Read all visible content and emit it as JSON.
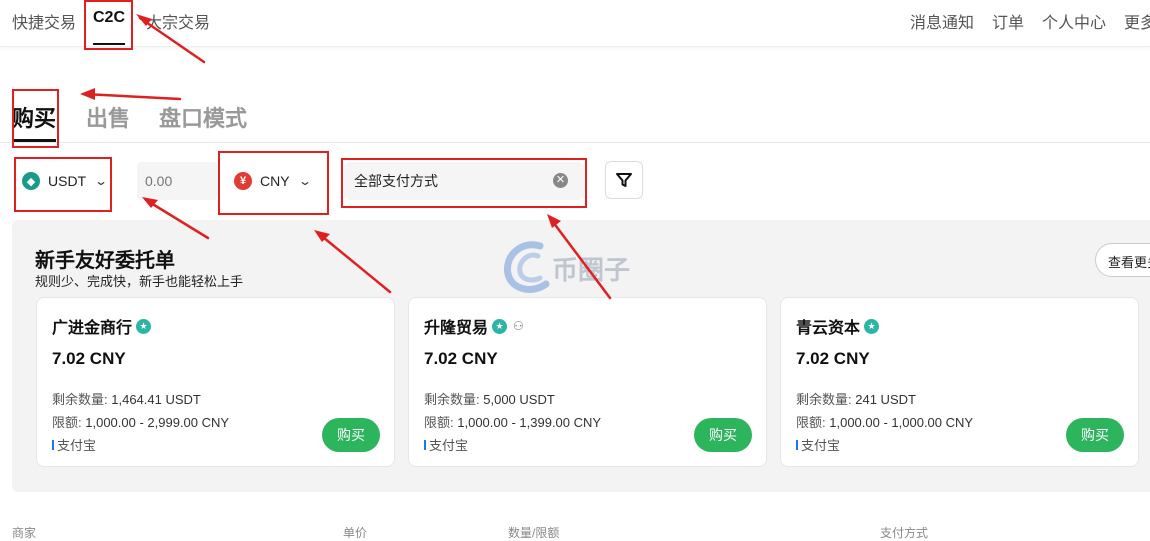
{
  "topnav": {
    "left": [
      "快捷交易",
      "C2C",
      "大宗交易"
    ],
    "right": [
      "消息通知",
      "订单",
      "个人中心",
      "更多"
    ]
  },
  "tabs": [
    "购买",
    "出售",
    "盘口模式"
  ],
  "filters": {
    "coin": "USDT",
    "amount_placeholder": "0.00",
    "fiat": "CNY",
    "payment": "全部支付方式"
  },
  "promo": {
    "title": "新手友好委托单",
    "subtitle": "规则少、完成快，新手也能轻松上手",
    "view_more": "查看更多"
  },
  "cards": [
    {
      "merchant": "广进金商行",
      "price": "7.02 CNY",
      "remaining_label": "剩余数量:",
      "remaining": "1,464.41 USDT",
      "limit_label": "限额:",
      "limit": "1,000.00 - 2,999.00 CNY",
      "payment": "支付宝",
      "button": "购买"
    },
    {
      "merchant": "升隆贸易",
      "price": "7.02 CNY",
      "remaining_label": "剩余数量:",
      "remaining": "5,000 USDT",
      "limit_label": "限额:",
      "limit": "1,000.00 - 1,399.00 CNY",
      "payment": "支付宝",
      "button": "购买"
    },
    {
      "merchant": "青云资本",
      "price": "7.02 CNY",
      "remaining_label": "剩余数量:",
      "remaining": "241 USDT",
      "limit_label": "限额:",
      "limit": "1,000.00 - 1,000.00 CNY",
      "payment": "支付宝",
      "button": "购买"
    }
  ],
  "table_headers": [
    "商家",
    "单价",
    "数量/限额",
    "支付方式"
  ],
  "watermark": "币圈子",
  "colors": {
    "buy_button": "#2db55d",
    "annotation": "#e02020",
    "verified": "#2bb5a6"
  }
}
